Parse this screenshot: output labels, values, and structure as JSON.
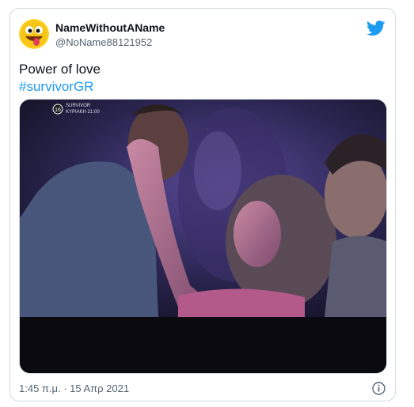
{
  "tweet": {
    "display_name": "NameWithoutAName",
    "handle": "@NoName88121952",
    "text": "Power of love",
    "hashtag": "#survivorGR",
    "timestamp": "1:45 π.μ. · 15 Απρ 2021"
  },
  "media": {
    "tv_rating": "16",
    "channel_label": "SURVIVOR",
    "schedule_label": "ΚΥΡΙΑΚΗ 21:00"
  },
  "icons": {
    "brand": "twitter-bird-icon",
    "info": "info-icon",
    "avatar": "yellow-smiley-tongue-avatar"
  },
  "colors": {
    "link": "#1d9bf0",
    "brand": "#1d9bf0",
    "text": "#0f1419",
    "muted": "#536471",
    "border": "#cfd9de"
  }
}
